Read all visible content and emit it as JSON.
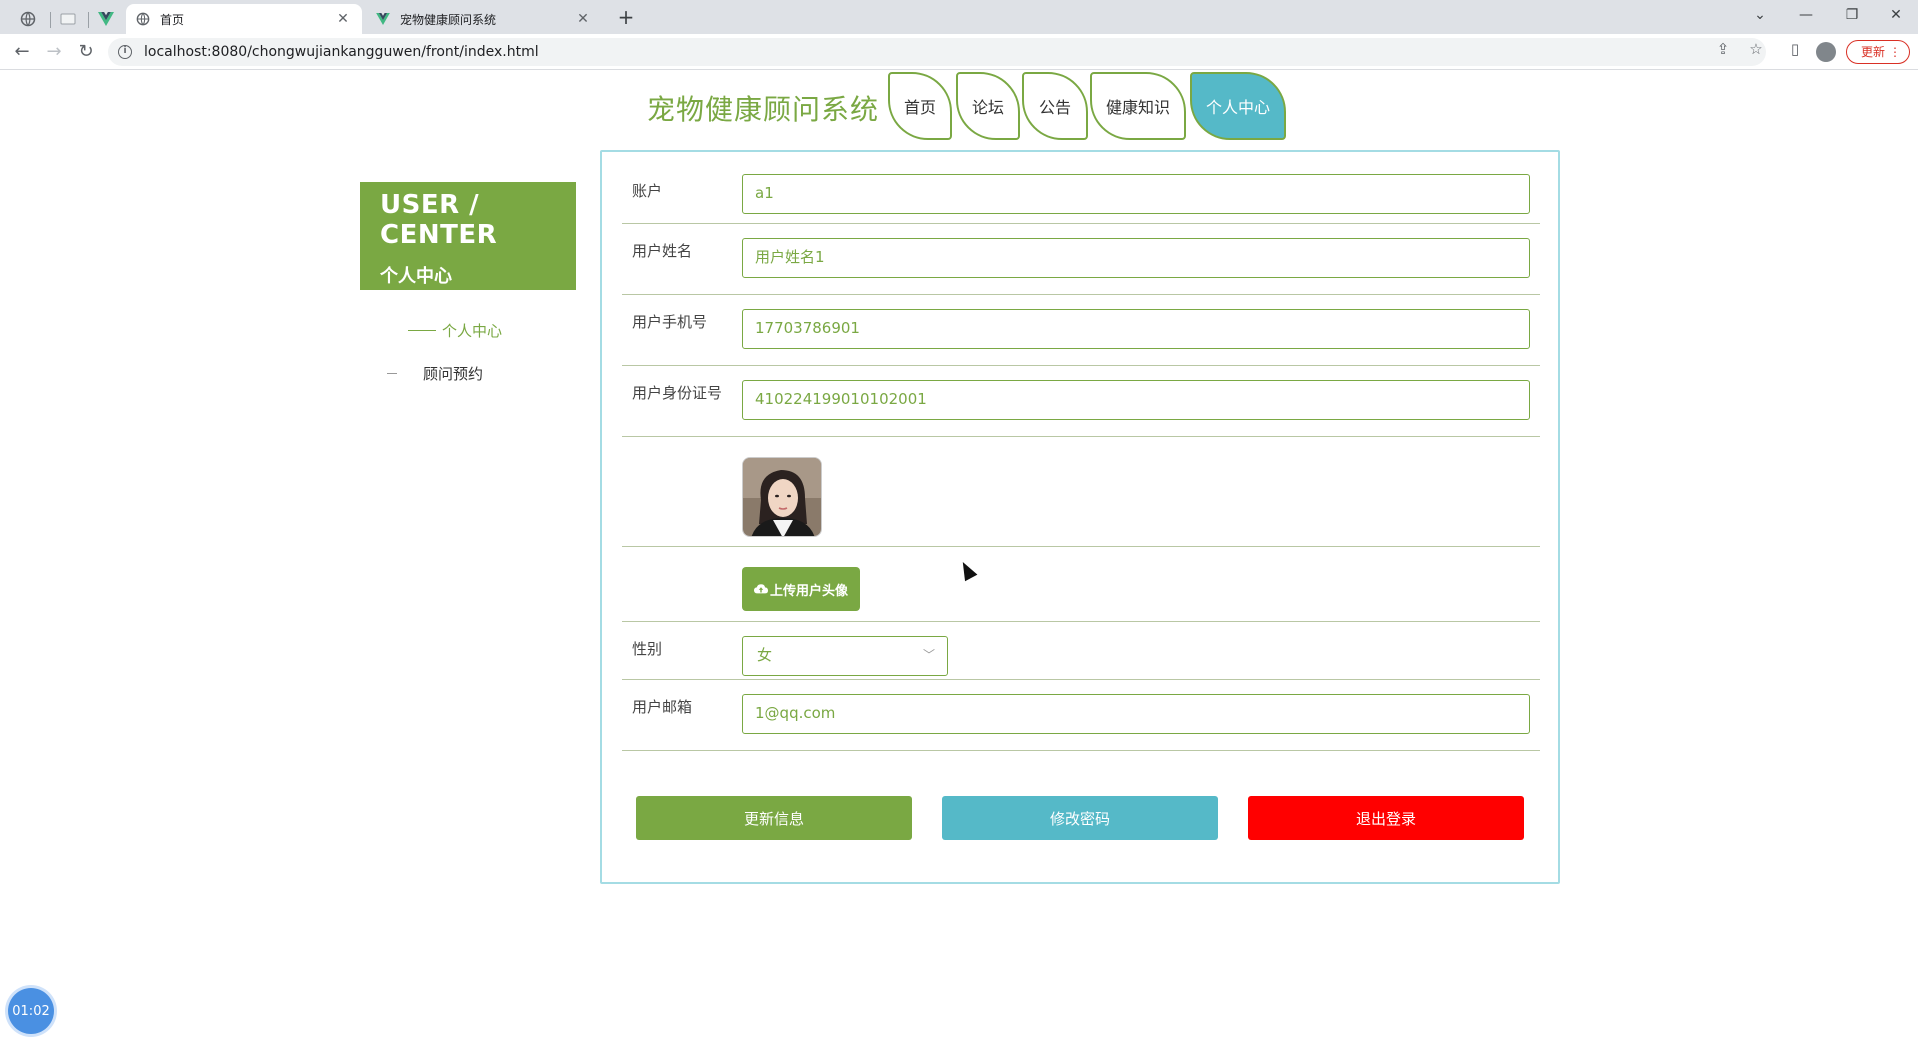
{
  "browser": {
    "tabs": [
      {
        "title": "首页",
        "active": true
      },
      {
        "title": "宠物健康顾问系统",
        "active": false
      }
    ],
    "new_tab_label": "+",
    "url": "localhost:8080/chongwujiankangguwen/front/index.html",
    "update_label": "更新"
  },
  "header": {
    "site_title": "宠物健康顾问系统",
    "nav": [
      "首页",
      "论坛",
      "公告",
      "健康知识",
      "个人中心"
    ],
    "active_nav": "个人中心"
  },
  "sidebar": {
    "heading_en": "USER / CENTER",
    "heading_cn": "个人中心",
    "items": [
      {
        "label": "个人中心",
        "active": true
      },
      {
        "label": "顾问预约",
        "active": false
      }
    ]
  },
  "form": {
    "fields": [
      {
        "label": "账户",
        "value": "a1"
      },
      {
        "label": "用户姓名",
        "value": "用户姓名1"
      },
      {
        "label": "用户手机号",
        "value": "17703786901"
      },
      {
        "label": "用户身份证号",
        "value": "410224199010102001"
      }
    ],
    "upload_label": "上传用户头像",
    "gender": {
      "label": "性别",
      "value": "女"
    },
    "email": {
      "label": "用户邮箱",
      "value": "1@qq.com"
    },
    "buttons": {
      "update": "更新信息",
      "change_password": "修改密码",
      "logout": "退出登录"
    }
  },
  "colors": {
    "primary_green": "#7aa843",
    "teal": "#55b9c8",
    "danger_red": "#ff0000",
    "panel_border": "#a4dce4"
  },
  "timer": "01:02"
}
